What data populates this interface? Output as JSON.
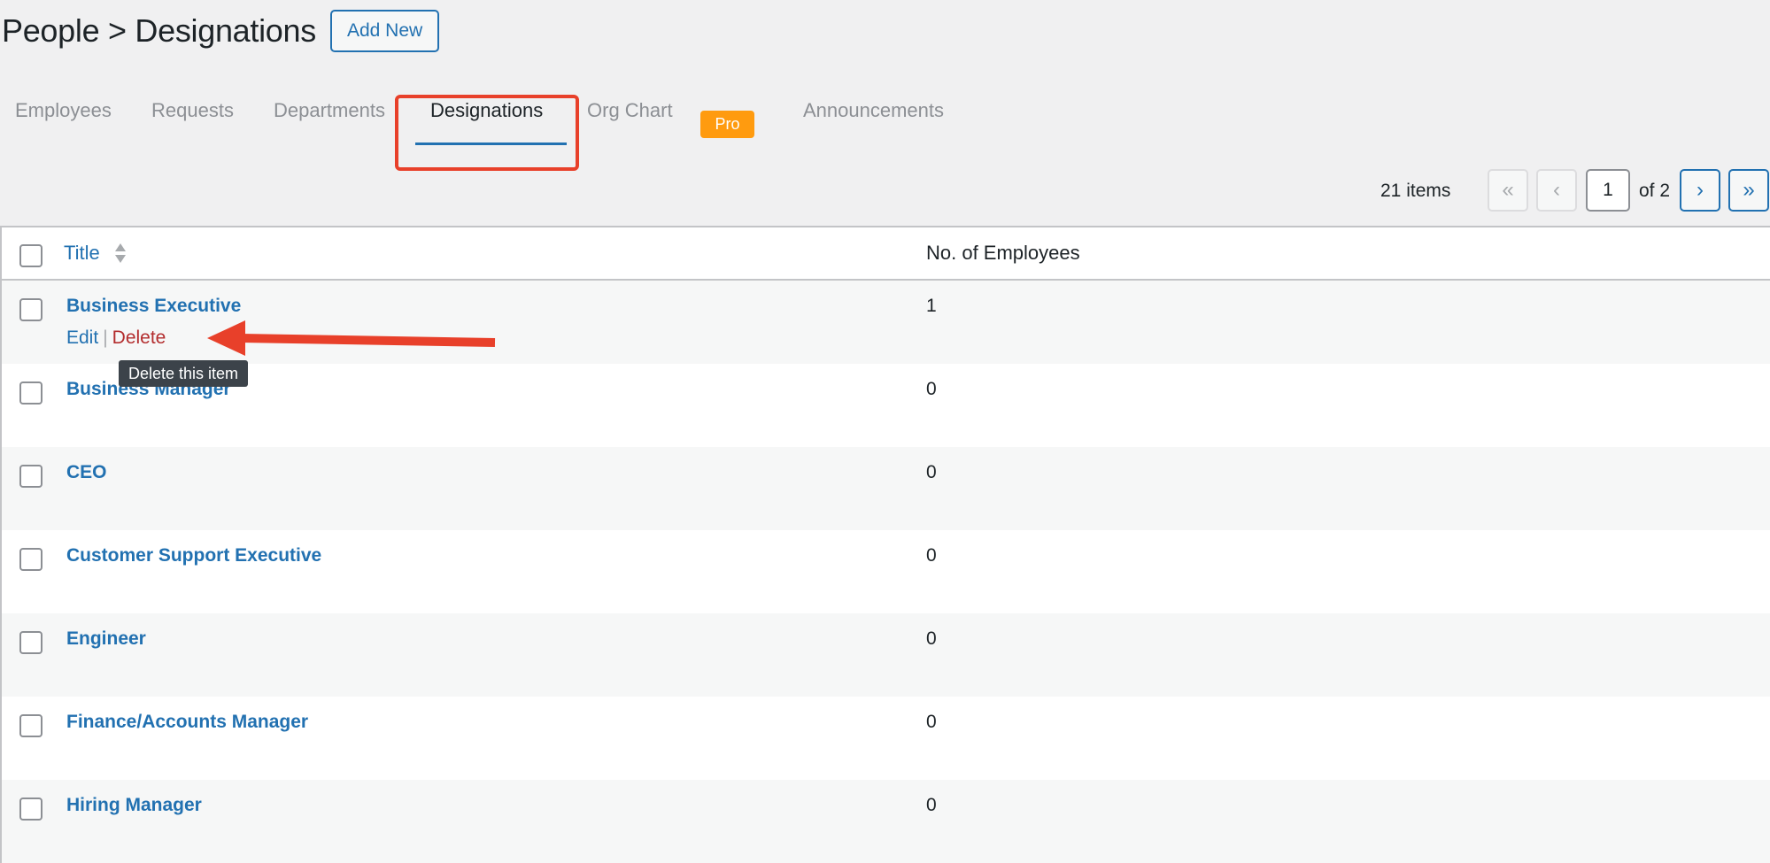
{
  "header": {
    "title": "People > Designations",
    "add_new_label": "Add New"
  },
  "tabs": [
    {
      "label": "Employees",
      "active": false
    },
    {
      "label": "Requests",
      "active": false
    },
    {
      "label": "Departments",
      "active": false
    },
    {
      "label": "Designations",
      "active": true
    },
    {
      "label": "Org Chart",
      "active": false
    },
    {
      "label": "Announcements",
      "active": false
    }
  ],
  "pro_badge": "Pro",
  "pagination": {
    "items_count": "21 items",
    "first_icon": "«",
    "prev_icon": "‹",
    "current_page": "1",
    "of_label": "of 2",
    "next_icon": "›",
    "last_icon": "»"
  },
  "table": {
    "col_title": "Title",
    "col_employees": "No. of Employees",
    "rows": [
      {
        "title": "Business Executive",
        "count": "1"
      },
      {
        "title": "Business Manager",
        "count": "0"
      },
      {
        "title": "CEO",
        "count": "0"
      },
      {
        "title": "Customer Support Executive",
        "count": "0"
      },
      {
        "title": "Engineer",
        "count": "0"
      },
      {
        "title": "Finance/Accounts Manager",
        "count": "0"
      },
      {
        "title": "Hiring Manager",
        "count": "0"
      }
    ],
    "row_actions": {
      "edit": "Edit",
      "separator": "|",
      "delete": "Delete"
    }
  },
  "tooltip": "Delete this item",
  "colors": {
    "accent": "#2271b1",
    "delete": "#b32d2e",
    "pro": "#ff9b0f",
    "annotation": "#e8402a"
  }
}
